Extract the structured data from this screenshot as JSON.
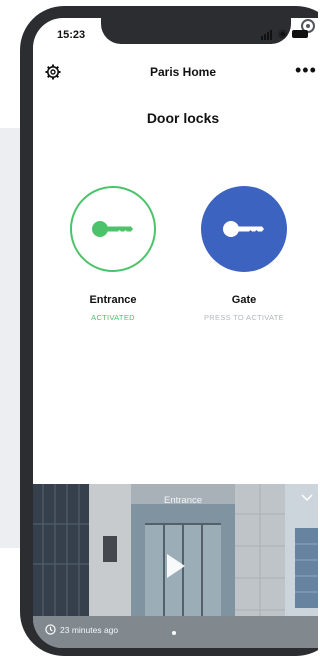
{
  "status_bar": {
    "time": "15:23"
  },
  "header": {
    "home_name": "Paris Home"
  },
  "main": {
    "title": "Door locks",
    "locks": [
      {
        "label": "Entrance",
        "status": "ACTIVATED",
        "status_color": "#4cc36a",
        "icon": "key-icon"
      },
      {
        "label": "Gate",
        "status": "PRESS TO ACTIVATE",
        "status_color": "#b4b8bd",
        "icon": "key-icon"
      }
    ]
  },
  "camera": {
    "label": "Entrance",
    "last_seen": "23 minutes ago"
  },
  "colors": {
    "accent_green": "#4cc36a",
    "accent_blue": "#3d63c1",
    "phone_frame": "#2c2d30"
  }
}
